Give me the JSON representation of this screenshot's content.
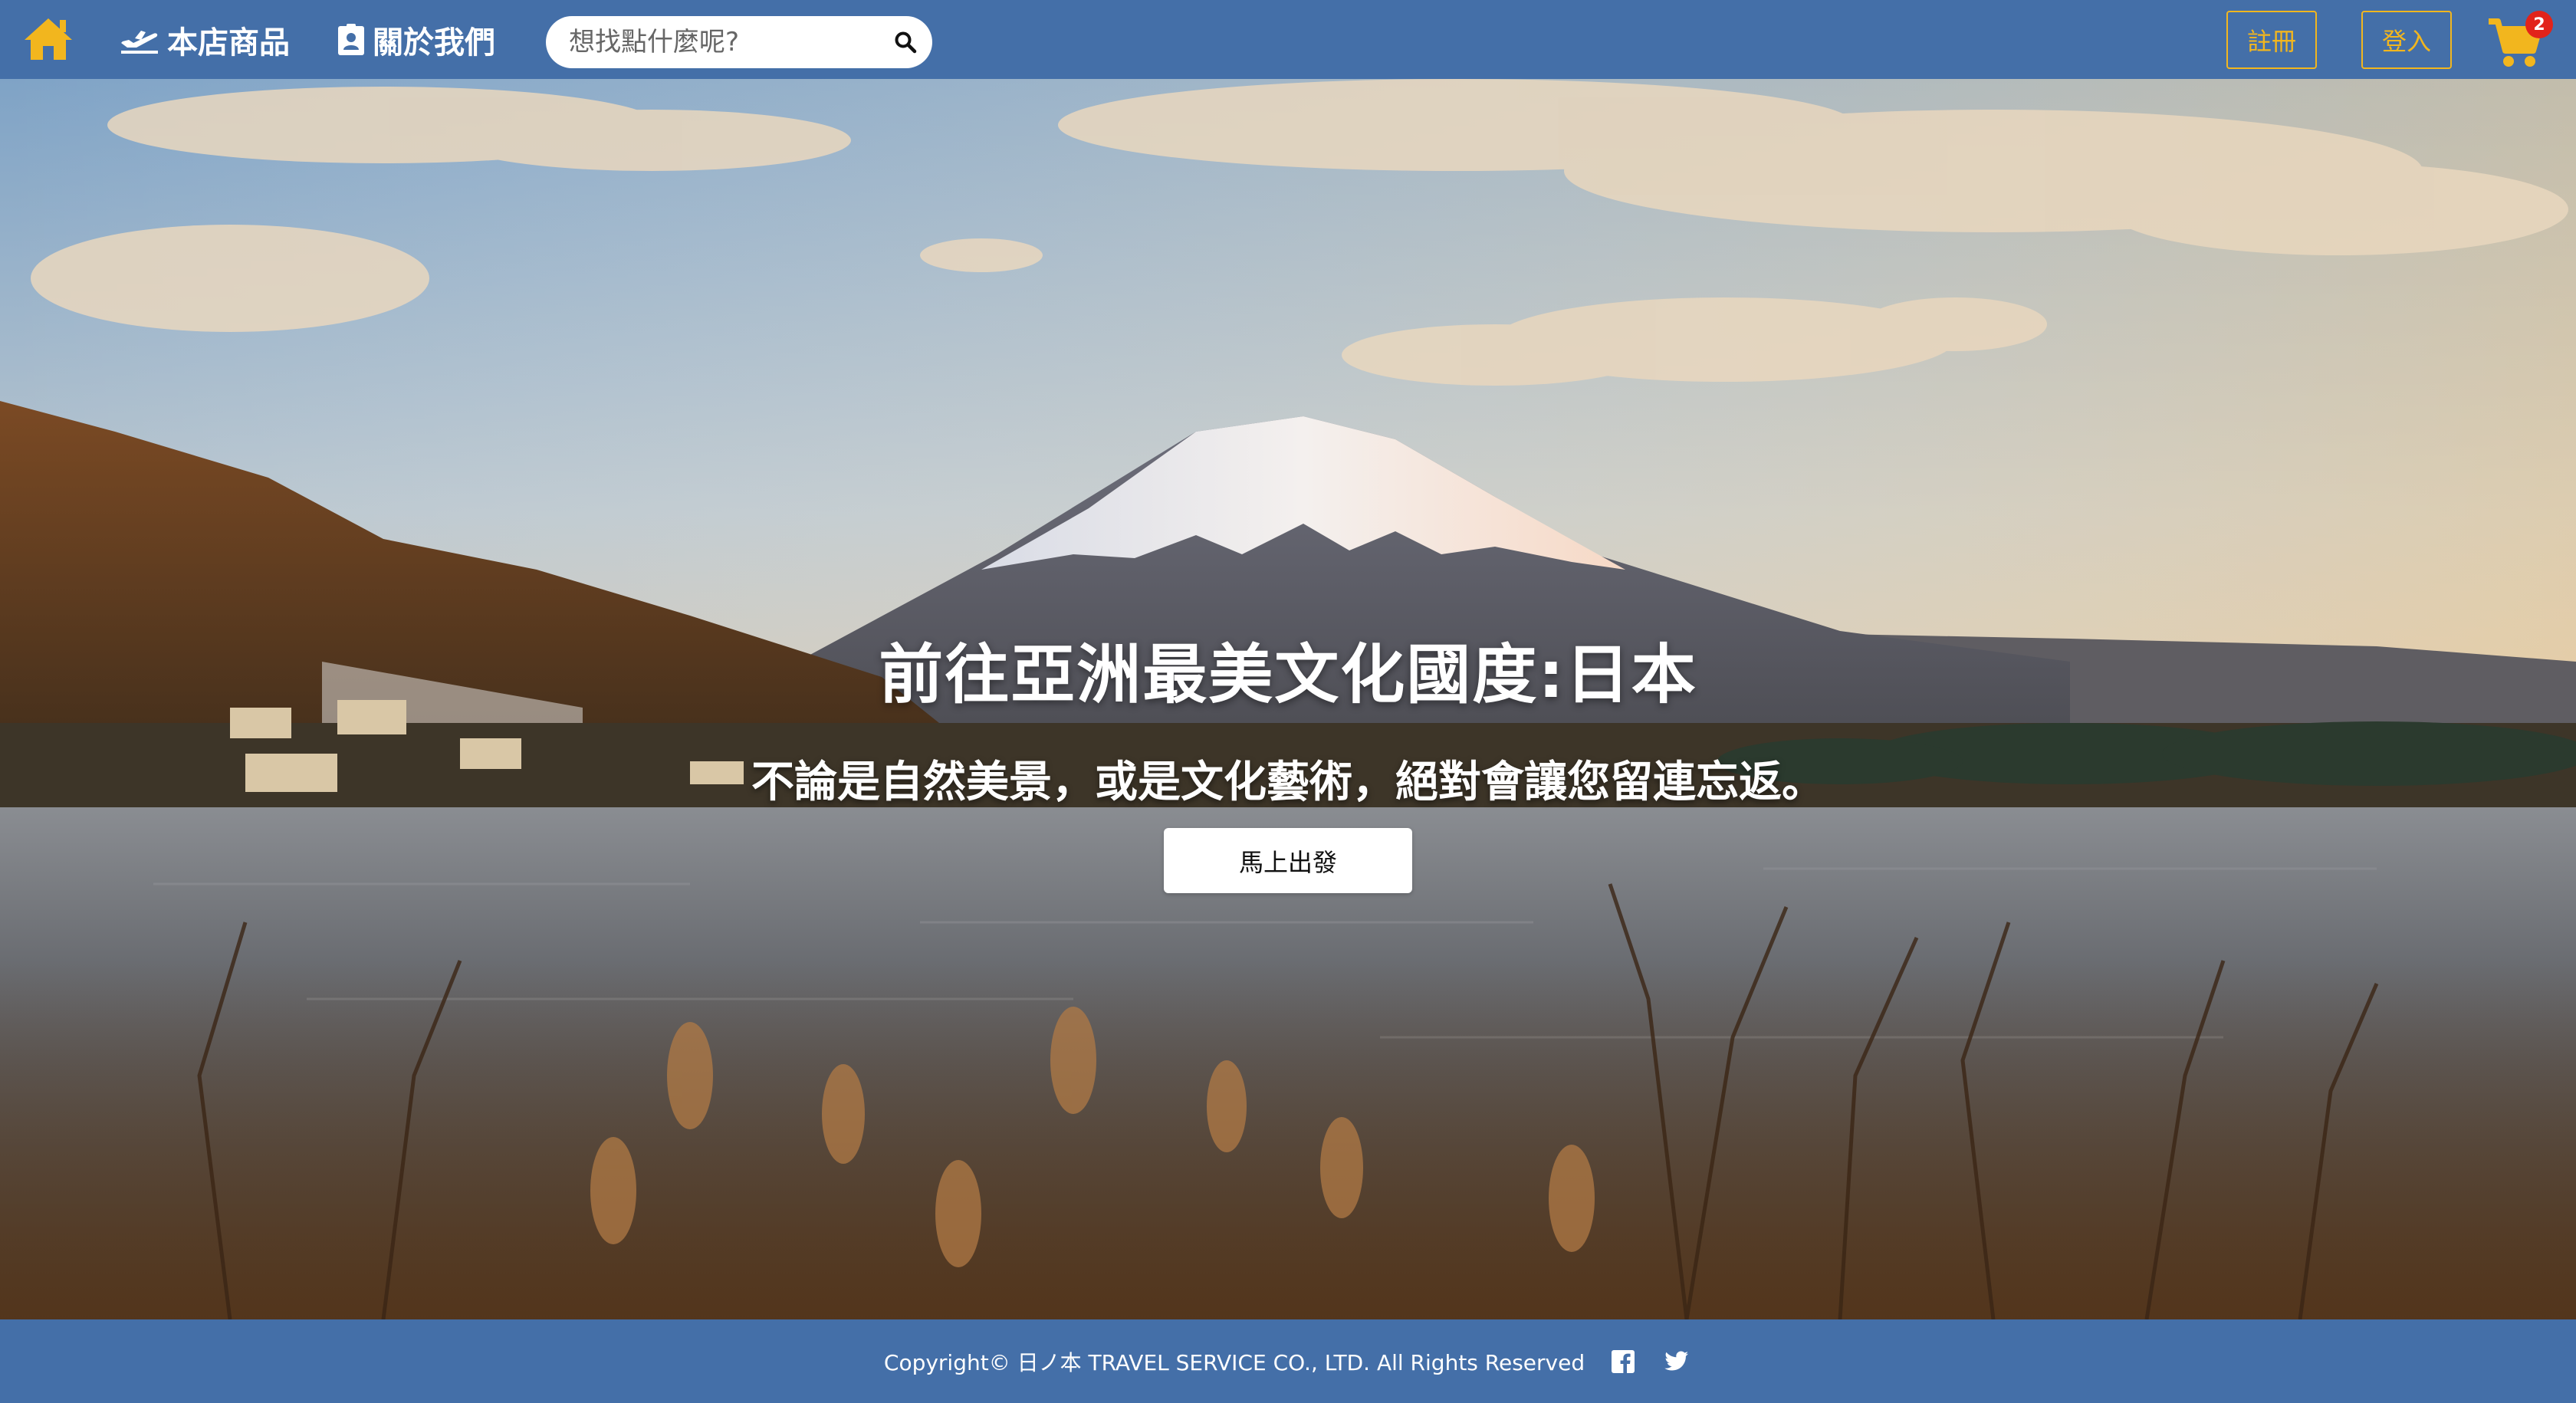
{
  "navbar": {
    "home_icon": "home-icon",
    "products_label": "本店商品",
    "products_icon": "plane-departure-icon",
    "about_label": "關於我們",
    "about_icon": "id-badge-icon",
    "search": {
      "placeholder": "想找點什麼呢?",
      "value": "",
      "icon": "search-icon"
    },
    "register_label": "註冊",
    "login_label": "登入",
    "cart": {
      "icon": "shopping-cart-icon",
      "count": "2"
    }
  },
  "hero": {
    "title": "前往亞洲最美文化國度:日本",
    "subtitle": "不論是自然美景，或是文化藝術，絕對會讓您留連忘返。",
    "cta_label": "馬上出發"
  },
  "footer": {
    "copyright": "Copyright© 日ノ本 TRAVEL SERVICE CO., LTD. All Rights Reserved",
    "social": [
      "facebook-icon",
      "twitter-icon"
    ]
  },
  "colors": {
    "brand_blue": "#446fa8",
    "accent_gold": "#f2b61e",
    "badge_red": "#e2231a"
  }
}
